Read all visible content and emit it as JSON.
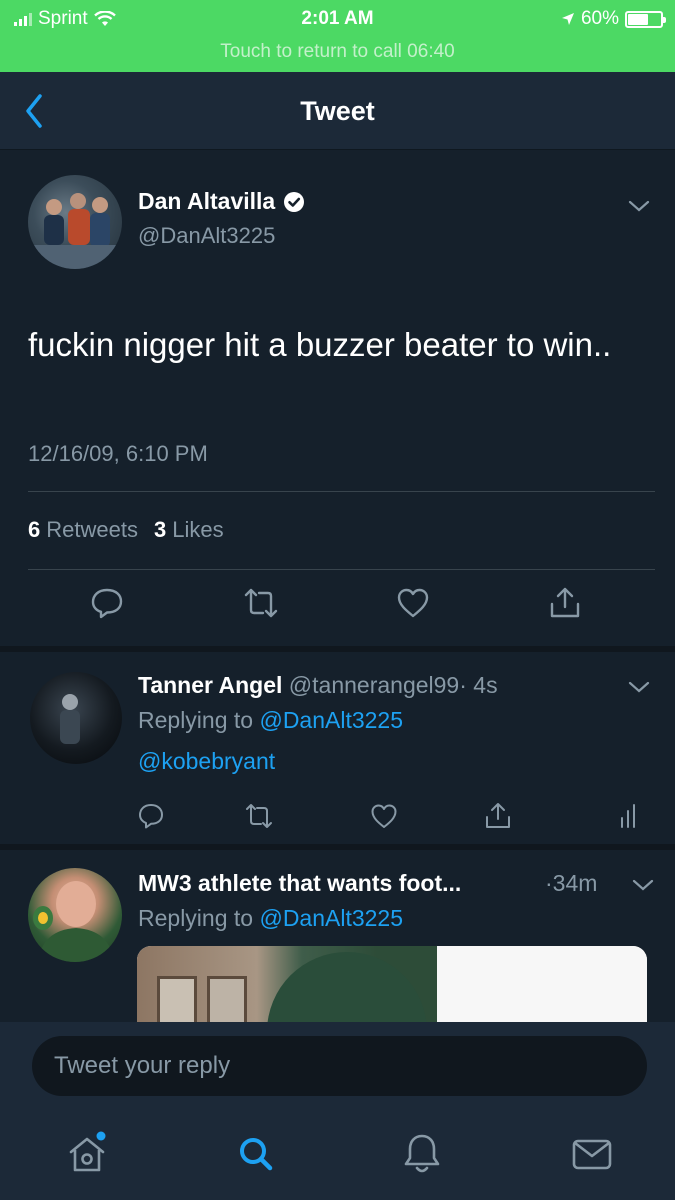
{
  "status_bar": {
    "carrier": "Sprint",
    "time": "2:01 AM",
    "battery": "60%",
    "battery_level": 0.6,
    "call_banner": "Touch to return to call 06:40"
  },
  "nav": {
    "title": "Tweet"
  },
  "tweet": {
    "author_name": "Dan Altavilla",
    "author_handle": "@DanAlt3225",
    "text": "fuckin nigger hit a buzzer beater to win..",
    "date": "12/16/09, 6:10 PM",
    "retweets_count": "6",
    "retweets_label": "Retweets",
    "likes_count": "3",
    "likes_label": "Likes"
  },
  "replies": [
    {
      "name": "Tanner Angel",
      "handle": "@tannerangel99",
      "time": "· 4s",
      "replying_prefix": "Replying to",
      "replying_to": "@DanAlt3225",
      "text": "@kobebryant"
    },
    {
      "name": "MW3 athlete that wants foot...",
      "time": "·34m",
      "replying_prefix": "Replying to",
      "replying_to": "@DanAlt3225"
    }
  ],
  "compose": {
    "placeholder": "Tweet your reply"
  },
  "colors": {
    "status_green": "#4cd964",
    "background": "#15202b",
    "accent_blue": "#1da1f2",
    "secondary_text": "#8899a6"
  },
  "icons": [
    "back-chevron-icon",
    "verified-icon",
    "reply-icon",
    "retweet-icon",
    "like-icon",
    "share-icon",
    "analytics-icon",
    "home-icon",
    "search-icon",
    "notifications-icon",
    "messages-icon"
  ]
}
